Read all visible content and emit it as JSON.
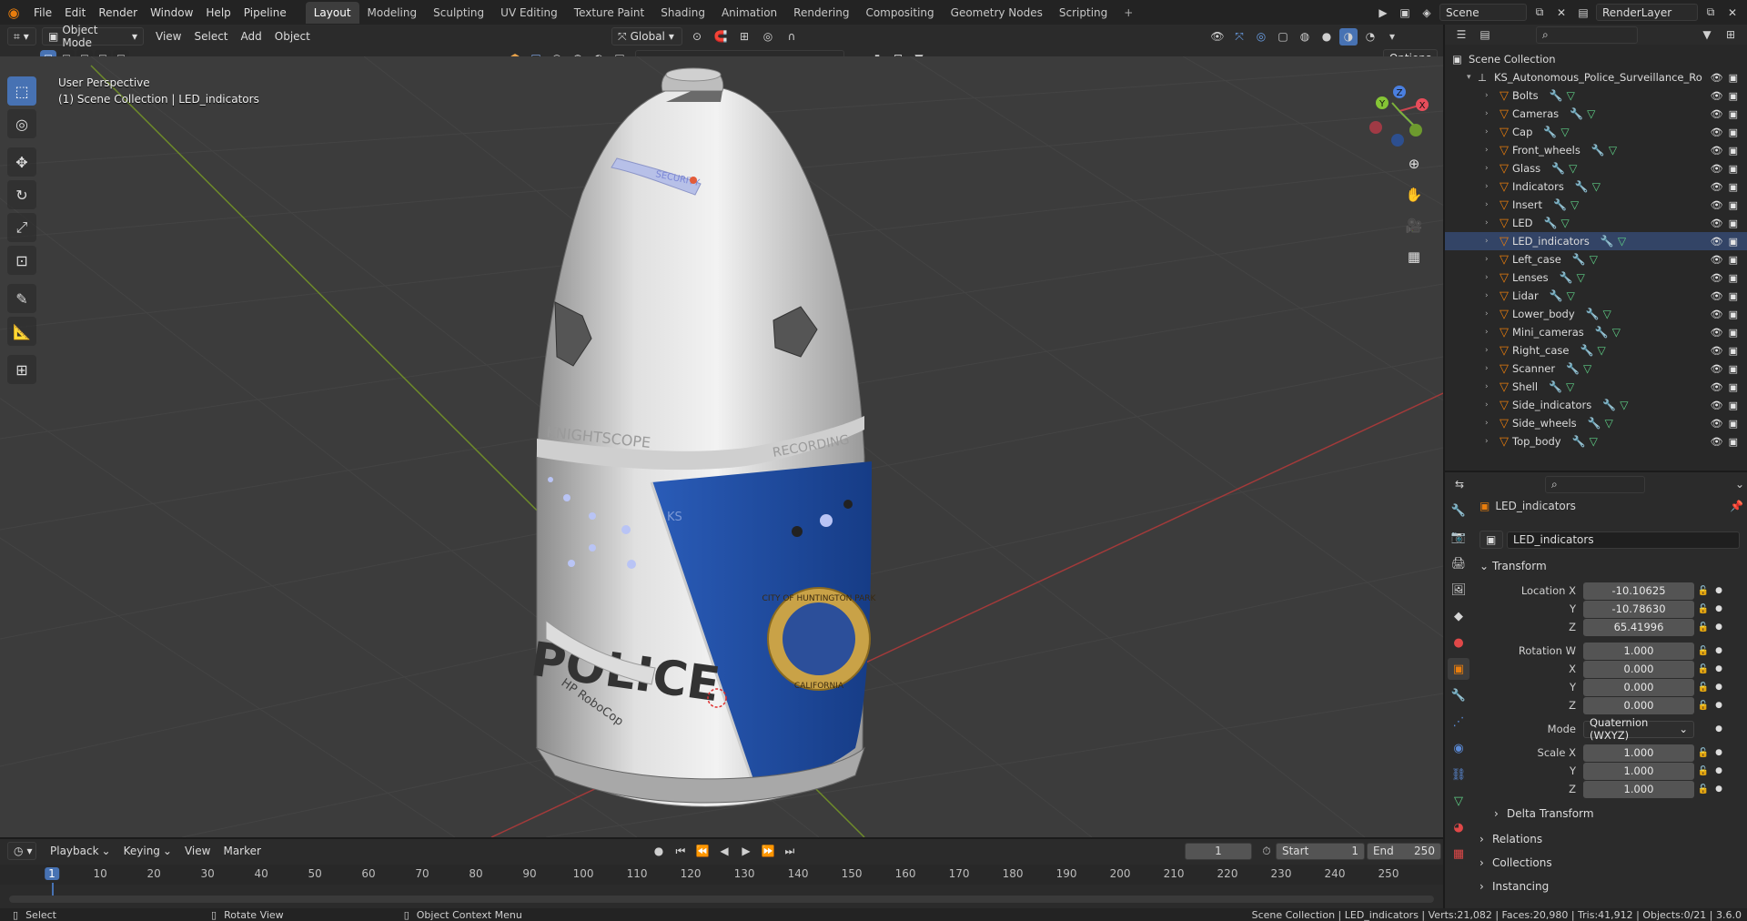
{
  "menu": [
    "File",
    "Edit",
    "Render",
    "Window",
    "Help",
    "Pipeline"
  ],
  "workspaces": [
    "Layout",
    "Modeling",
    "Sculpting",
    "UV Editing",
    "Texture Paint",
    "Shading",
    "Animation",
    "Rendering",
    "Compositing",
    "Geometry Nodes",
    "Scripting"
  ],
  "active_workspace": "Layout",
  "scene_name": "Scene",
  "render_layer": "RenderLayer",
  "viewport_header": {
    "mode": "Object Mode",
    "menus": [
      "View",
      "Select",
      "Add",
      "Object"
    ],
    "transform_orientation": "Global",
    "options": "Options"
  },
  "viewport": {
    "perspective": "User Perspective",
    "context": "(1) Scene Collection | LED_indicators",
    "gizmo_axes": [
      "X",
      "Y",
      "Z"
    ],
    "model_labels": {
      "security": "SECURITY",
      "knightscope": "KNIGHTSCOPE",
      "recording": "RECORDING",
      "police": "POLICE",
      "ks": "KS",
      "robocop": "HP RoboCop",
      "seal_top": "CITY OF HUNTINGTON PARK",
      "seal_bottom": "CALIFORNIA"
    }
  },
  "outliner": {
    "root": "Scene Collection",
    "collection": "KS_Autonomous_Police_Surveillance_Ro",
    "items": [
      "Bolts",
      "Cameras",
      "Cap",
      "Front_wheels",
      "Glass",
      "Indicators",
      "Insert",
      "LED",
      "LED_indicators",
      "Left_case",
      "Lenses",
      "Lidar",
      "Lower_body",
      "Mini_cameras",
      "Right_case",
      "Scanner",
      "Shell",
      "Side_indicators",
      "Side_wheels",
      "Top_body"
    ],
    "selected": "LED_indicators"
  },
  "properties": {
    "object_name": "LED_indicators",
    "datablock_name": "LED_indicators",
    "transform_label": "Transform",
    "location_label": "Location X",
    "location": [
      "-10.10625",
      "-10.78630",
      "65.41996"
    ],
    "rotation_label": "Rotation W",
    "rotation": [
      "1.000",
      "0.000",
      "0.000",
      "0.000"
    ],
    "mode_label": "Mode",
    "mode_value": "Quaternion (WXYZ)",
    "scale_label": "Scale X",
    "scale": [
      "1.000",
      "1.000",
      "1.000"
    ],
    "axis_y": "Y",
    "axis_z": "Z",
    "axis_x": "X",
    "sections": [
      "Delta Transform",
      "Relations",
      "Collections",
      "Instancing"
    ]
  },
  "timeline": {
    "menus": [
      "Playback",
      "Keying",
      "View",
      "Marker"
    ],
    "current_frame": "1",
    "start_label": "Start",
    "start": "1",
    "end_label": "End",
    "end": "250",
    "ticks": [
      "1",
      "10",
      "20",
      "30",
      "40",
      "50",
      "60",
      "70",
      "80",
      "90",
      "100",
      "110",
      "120",
      "130",
      "140",
      "150",
      "160",
      "170",
      "180",
      "190",
      "200",
      "210",
      "220",
      "230",
      "240",
      "250"
    ]
  },
  "status": {
    "select": "Select",
    "rotate": "Rotate View",
    "context_menu": "Object Context Menu",
    "stats": "Scene Collection | LED_indicators | Verts:21,082 | Faces:20,980 | Tris:41,912 | Objects:0/21 | 3.6.0"
  },
  "colors": {
    "accent": "#4772b3",
    "object_orange": "#e87d0d",
    "mesh_green": "#5fcf86",
    "police_blue": "#1f4fa3"
  }
}
